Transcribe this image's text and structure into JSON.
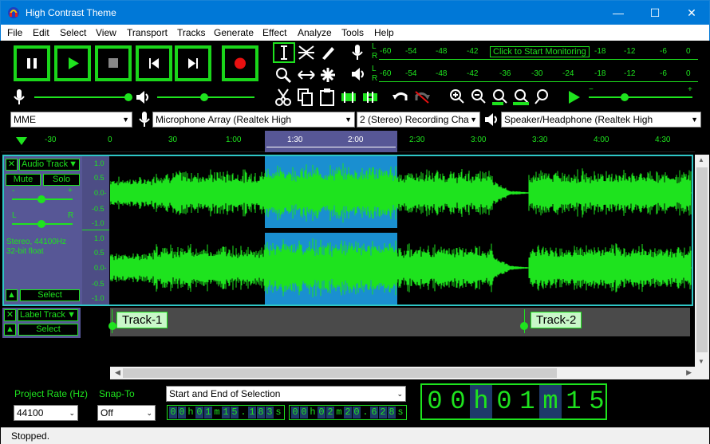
{
  "window": {
    "title": "High Contrast Theme",
    "min": "—",
    "max": "☐",
    "close": "✕"
  },
  "menu": [
    "File",
    "Edit",
    "Select",
    "View",
    "Transport",
    "Tracks",
    "Generate",
    "Effect",
    "Analyze",
    "Tools",
    "Help"
  ],
  "meters": {
    "rec_ticks": [
      "-60",
      "-54",
      "-48",
      "-42",
      "-18",
      "-12",
      "-6",
      "0"
    ],
    "play_ticks": [
      "-60",
      "-54",
      "-48",
      "-42",
      "-36",
      "-30",
      "-24",
      "-18",
      "-12",
      "-6",
      "0"
    ],
    "monitor_button": "Click to Start Monitoring",
    "lr": [
      "L",
      "R"
    ]
  },
  "devices": {
    "host": "MME",
    "mic": "Microphone Array (Realtek High",
    "channels": "2 (Stereo) Recording Cha",
    "speaker": "Speaker/Headphone (Realtek High"
  },
  "ruler": {
    "ticks": [
      "-30",
      "0",
      "30",
      "1:00",
      "1:30",
      "2:00",
      "2:30",
      "3:00",
      "3:30",
      "4:00",
      "4:30"
    ]
  },
  "track": {
    "name": "Audio Track",
    "mute": "Mute",
    "solo": "Solo",
    "gain_minus": "-",
    "gain_plus": "+",
    "pan_l": "L",
    "pan_r": "R",
    "info1": "Stereo, 44100Hz",
    "info2": "32-bit float",
    "select": "Select",
    "scale": [
      "1.0",
      "0.5",
      "0.0-",
      "-0.5",
      "-1.0"
    ]
  },
  "labeltrack": {
    "name": "Label Track",
    "select": "Select",
    "labels": [
      "Track-1",
      "Track-2"
    ]
  },
  "bottom": {
    "rate_label": "Project Rate (Hz)",
    "rate": "44100",
    "snap_label": "Snap-To",
    "snap": "Off",
    "sel_mode": "Start and End of Selection",
    "t1": [
      "0",
      "0",
      "h",
      "0",
      "1",
      "m",
      "1",
      "5",
      ".",
      "1",
      "8",
      "3",
      "s"
    ],
    "t2": [
      "0",
      "0",
      "h",
      "0",
      "2",
      "m",
      "2",
      "0",
      ".",
      "6",
      "2",
      "8",
      "s"
    ],
    "big": [
      "0",
      "0",
      "h",
      "0",
      "1",
      "m",
      "1",
      "5"
    ]
  },
  "status": "Stopped."
}
